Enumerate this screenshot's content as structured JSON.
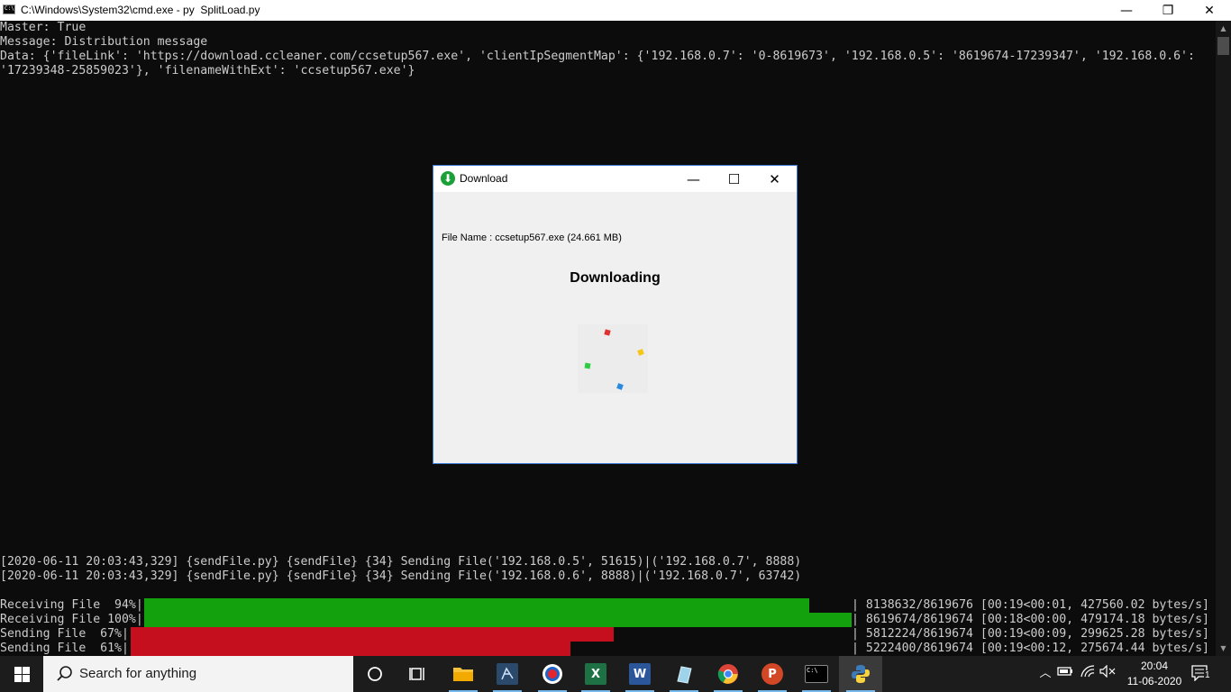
{
  "window": {
    "title": "C:\\Windows\\System32\\cmd.exe - py  SplitLoad.py",
    "minimize": "—",
    "restore": "❐",
    "close": "✕"
  },
  "console": {
    "header_lines": [
      "Master: True",
      "Message: Distribution message",
      "Data: {'fileLink': 'https://download.ccleaner.com/ccsetup567.exe', 'clientIpSegmentMap': {'192.168.0.7': '0-8619673', '192.168.0.5': '8619674-17239347', '192.168.0.6':",
      "'17239348-25859023'}, 'filenameWithExt': 'ccsetup567.exe'}"
    ],
    "log_lines": [
      "[2020-06-11 20:03:43,329] {sendFile.py} {sendFile} {34} Sending File('192.168.0.5', 51615)|('192.168.0.7', 8888)",
      "[2020-06-11 20:03:43,329] {sendFile.py} {sendFile} {34} Sending File('192.168.0.6', 8888)|('192.168.0.7', 63742)"
    ],
    "progress_bars": [
      {
        "label": "Receiving File  94%|",
        "percent": 94,
        "color": "#13a10e",
        "stats": "| 8138632/8619676 [00:19<00:01, 427560.02 bytes/s]"
      },
      {
        "label": "Receiving File 100%|",
        "percent": 100,
        "color": "#13a10e",
        "stats": "| 8619674/8619674 [00:18<00:00, 479174.18 bytes/s]"
      },
      {
        "label": "Sending File  67%|",
        "percent": 67,
        "color": "#c50f1f",
        "stats": "| 5812224/8619674 [00:19<00:09, 299625.28 bytes/s]"
      },
      {
        "label": "Sending File  61%|",
        "percent": 61,
        "color": "#c50f1f",
        "stats": "| 5222400/8619674 [00:19<00:12, 275674.44 bytes/s]"
      }
    ]
  },
  "dialog": {
    "title": "Download",
    "minimize": "—",
    "maximize": "☐",
    "close": "✕",
    "file_name": "File Name : ccsetup567.exe (24.661 MB)",
    "status": "Downloading"
  },
  "taskbar": {
    "search_placeholder": "Search for anything",
    "apps": [
      {
        "name": "cortana",
        "icon": "circle-icon"
      },
      {
        "name": "task-view",
        "icon": "task-view-icon"
      },
      {
        "name": "file-explorer",
        "icon": "folder-icon"
      },
      {
        "name": "app-blue",
        "icon": "app-icon"
      },
      {
        "name": "app-red-circle",
        "icon": "record-icon"
      },
      {
        "name": "excel",
        "icon": "excel-icon",
        "letter": "X"
      },
      {
        "name": "word",
        "icon": "word-icon",
        "letter": "W"
      },
      {
        "name": "notepad",
        "icon": "notepad-icon"
      },
      {
        "name": "chrome",
        "icon": "chrome-icon"
      },
      {
        "name": "powerpoint",
        "icon": "powerpoint-icon",
        "letter": "P"
      },
      {
        "name": "cmd",
        "icon": "terminal-icon"
      },
      {
        "name": "python",
        "icon": "python-icon"
      }
    ],
    "clock_time": "20:04",
    "clock_date": "11-06-2020",
    "notification_count": "1"
  }
}
